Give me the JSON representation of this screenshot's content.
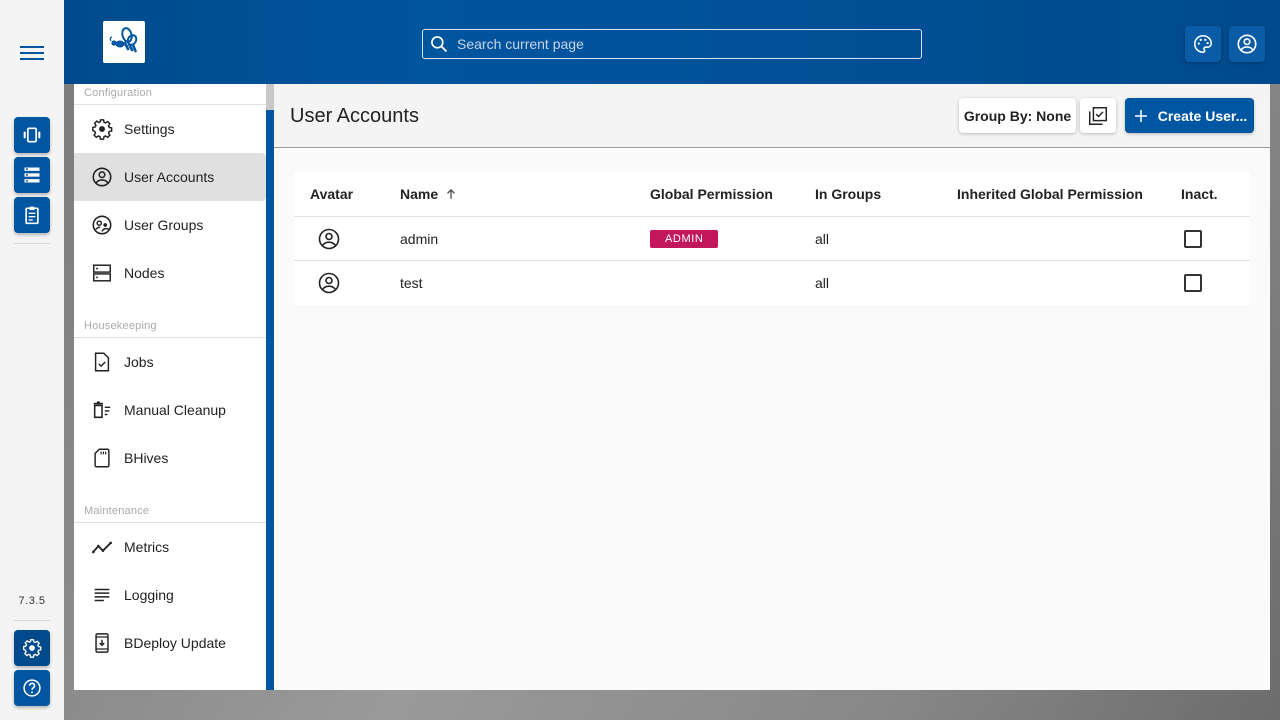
{
  "app": {
    "version": "7.3.5",
    "brand_color": "#0056a0",
    "search": {
      "placeholder": "Search current page",
      "value": ""
    }
  },
  "rail": {
    "menu_icon": "hamburger-menu-icon",
    "buttons": [
      {
        "name": "instances",
        "icon": "vibration-phone-icon"
      },
      {
        "name": "servers",
        "icon": "server-list-icon"
      },
      {
        "name": "reports",
        "icon": "clipboard-icon"
      }
    ],
    "bottom_buttons": [
      {
        "name": "administration",
        "icon": "gear-icon"
      },
      {
        "name": "help",
        "icon": "help-circle-icon"
      }
    ]
  },
  "topbar": {
    "logo": "bee-logo",
    "buttons": [
      {
        "name": "theme",
        "icon": "palette-icon"
      },
      {
        "name": "user",
        "icon": "account-circle-icon"
      }
    ]
  },
  "sidenav": {
    "sections": [
      {
        "title": "Configuration",
        "items": [
          {
            "label": "Settings",
            "icon": "gear-icon",
            "active": false
          },
          {
            "label": "User Accounts",
            "icon": "account-circle-icon",
            "active": true
          },
          {
            "label": "User Groups",
            "icon": "group-icon",
            "active": false
          },
          {
            "label": "Nodes",
            "icon": "dns-icon",
            "active": false
          }
        ]
      },
      {
        "title": "Housekeeping",
        "items": [
          {
            "label": "Jobs",
            "icon": "file-check-icon",
            "active": false
          },
          {
            "label": "Manual Cleanup",
            "icon": "cleanup-icon",
            "active": false
          },
          {
            "label": "BHives",
            "icon": "sd-card-icon",
            "active": false
          }
        ]
      },
      {
        "title": "Maintenance",
        "items": [
          {
            "label": "Metrics",
            "icon": "line-chart-icon",
            "active": false
          },
          {
            "label": "Logging",
            "icon": "notes-icon",
            "active": false
          },
          {
            "label": "BDeploy Update",
            "icon": "system-update-icon",
            "active": false
          }
        ]
      }
    ]
  },
  "main": {
    "title": "User Accounts",
    "group_by_label": "Group By: None",
    "bulk_select_icon": "library-add-check-icon",
    "create_label": "Create User...",
    "table": {
      "columns": [
        "Avatar",
        "Name",
        "Global Permission",
        "In Groups",
        "Inherited Global Permission",
        "Inact."
      ],
      "sort": {
        "column": "Name",
        "direction": "ascending"
      },
      "rows": [
        {
          "name": "admin",
          "permission": "ADMIN",
          "groups": "all",
          "inherited": "",
          "inactive": false
        },
        {
          "name": "test",
          "permission": "",
          "groups": "all",
          "inherited": "",
          "inactive": false
        }
      ]
    }
  }
}
